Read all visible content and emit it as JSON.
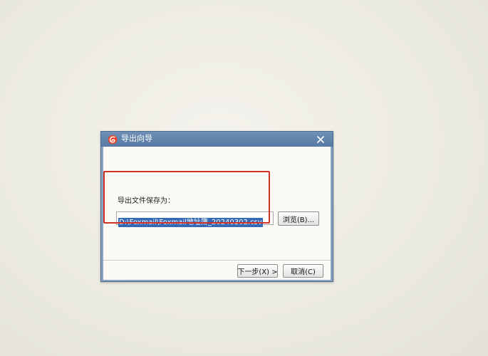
{
  "dialog": {
    "title": "导出向导",
    "app_icon": "foxmail-logo-icon",
    "close_icon": "close-icon"
  },
  "export": {
    "label": "导出文件保存为：",
    "path_value": "D:\\Foxmail\\Foxmail地址簿_20240302.csv",
    "browse_button": "浏览(B)..."
  },
  "footer": {
    "next_button": "下一步(X) >",
    "cancel_button": "取消(C)"
  },
  "colors": {
    "titlebar": "#5f81ab",
    "selection": "#3569b5",
    "highlight_border": "#d03226"
  }
}
